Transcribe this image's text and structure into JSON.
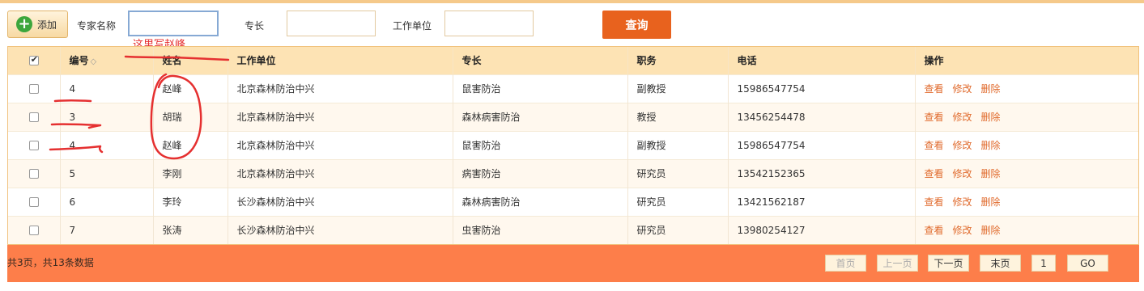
{
  "toolbar": {
    "add_label": "添加",
    "name_label": "专家名称",
    "name_value": "",
    "specialty_label": "专长",
    "specialty_value": "",
    "unit_label": "工作单位",
    "unit_value": "",
    "query_label": "查询"
  },
  "annotation": {
    "text": "这里写赵峰"
  },
  "table": {
    "columns": [
      "编号",
      "姓名",
      "工作单位",
      "专长",
      "职务",
      "电话",
      "操作"
    ],
    "sort_icon": "◇",
    "rows": [
      {
        "id": "4",
        "name": "赵峰",
        "unit": "北京森林防治中兴",
        "specialty": "鼠害防治",
        "title": "副教授",
        "phone": "15986547754"
      },
      {
        "id": "3",
        "name": "胡瑞",
        "unit": "北京森林防治中兴",
        "specialty": "森林病害防治",
        "title": "教授",
        "phone": "13456254478"
      },
      {
        "id": "4",
        "name": "赵峰",
        "unit": "北京森林防治中兴",
        "specialty": "鼠害防治",
        "title": "副教授",
        "phone": "15986547754"
      },
      {
        "id": "5",
        "name": "李刚",
        "unit": "北京森林防治中兴",
        "specialty": "病害防治",
        "title": "研究员",
        "phone": "13542152365"
      },
      {
        "id": "6",
        "name": "李玲",
        "unit": "长沙森林防治中兴",
        "specialty": "森林病害防治",
        "title": "研究员",
        "phone": "13421562187"
      },
      {
        "id": "7",
        "name": "张涛",
        "unit": "长沙森林防治中兴",
        "specialty": "虫害防治",
        "title": "研究员",
        "phone": "13980254127"
      }
    ],
    "actions": [
      "查看",
      "修改",
      "删除"
    ]
  },
  "footer": {
    "info": "共3页，共13条数据",
    "first": "首页",
    "prev": "上一页",
    "next": "下一页",
    "last": "末页",
    "page": "1",
    "go": "GO"
  },
  "colors": {
    "accent": "#e8621e",
    "header_bg": "#fde3b4",
    "footer_bg": "#fd7e4a",
    "link": "#e06a2c",
    "annotation": "#e53030"
  }
}
